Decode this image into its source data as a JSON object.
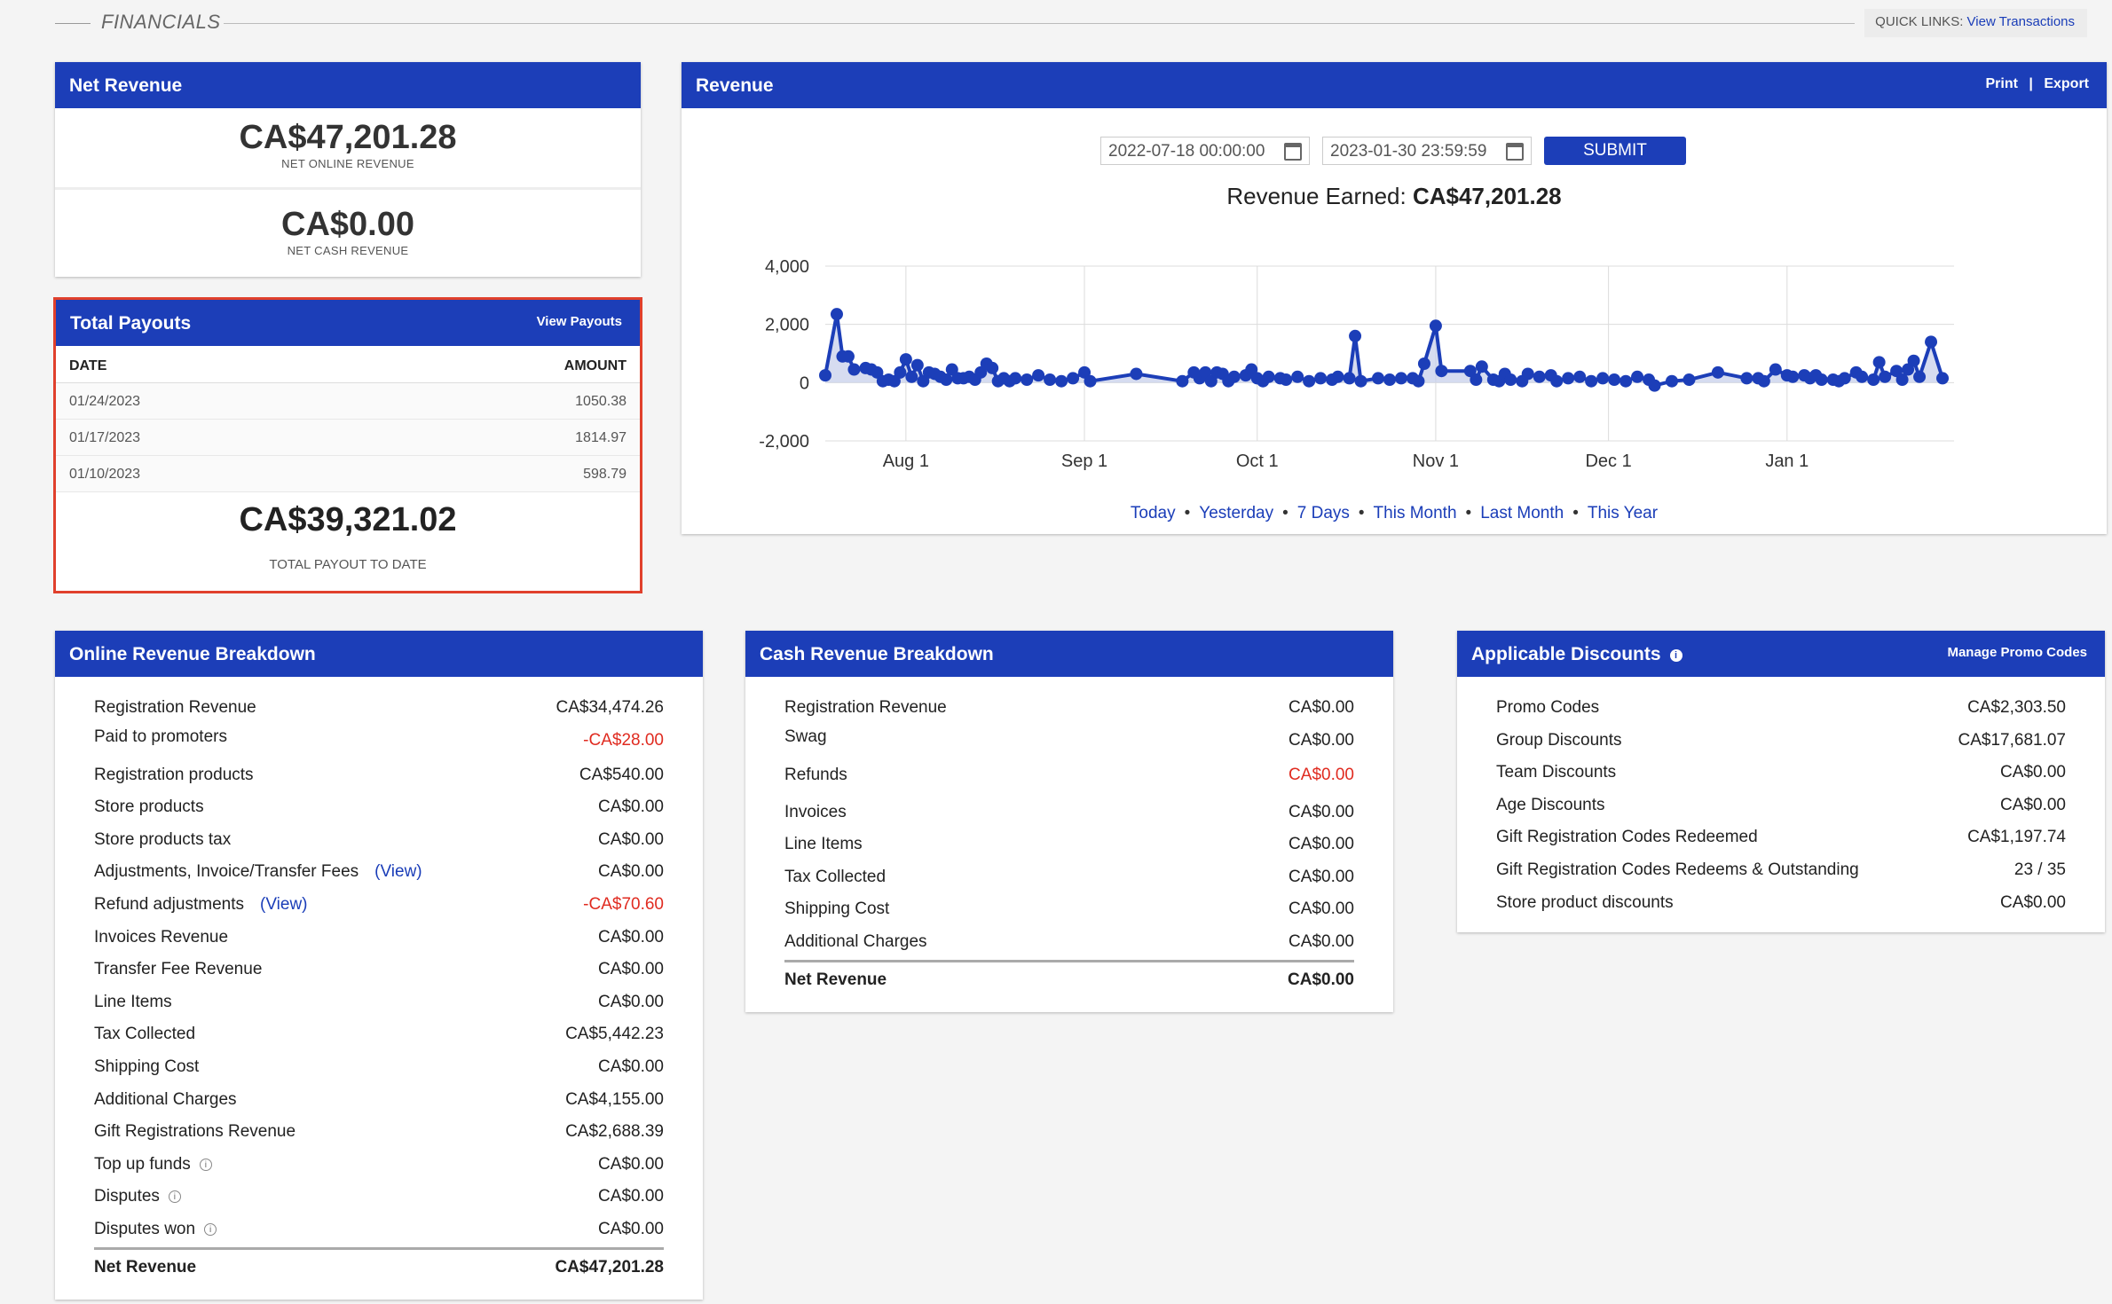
{
  "header": {
    "section_title": "FINANCIALS",
    "quick_links_label": "QUICK LINKS:",
    "quick_links_link": "View Transactions"
  },
  "net_revenue": {
    "title": "Net Revenue",
    "online_value": "CA$47,201.28",
    "online_caption": "NET ONLINE REVENUE",
    "cash_value": "CA$0.00",
    "cash_caption": "NET CASH REVENUE"
  },
  "payouts": {
    "title": "Total Payouts",
    "view_link": "View Payouts",
    "col_date": "DATE",
    "col_amount": "AMOUNT",
    "rows": [
      {
        "date": "01/24/2023",
        "amount": "1050.38"
      },
      {
        "date": "01/17/2023",
        "amount": "1814.97"
      },
      {
        "date": "01/10/2023",
        "amount": "598.79"
      }
    ],
    "total": "CA$39,321.02",
    "total_caption": "TOTAL PAYOUT TO DATE"
  },
  "revenue": {
    "title": "Revenue",
    "print": "Print",
    "separator": "|",
    "export": "Export",
    "start_date": "2022-07-18 00:00:00",
    "end_date": "2023-01-30 23:59:59",
    "submit": "SUBMIT",
    "earned_label": "Revenue Earned:",
    "earned_value": "CA$47,201.28",
    "ranges": [
      "Today",
      "Yesterday",
      "7 Days",
      "This Month",
      "Last Month",
      "This Year"
    ],
    "range_separator": "•"
  },
  "chart_data": {
    "type": "line",
    "title": "",
    "xlabel": "",
    "ylabel": "",
    "ylim": [
      -2000,
      4000
    ],
    "y_ticks": [
      "4,000",
      "2,000",
      "0",
      "-2,000"
    ],
    "y_tick_values": [
      4000,
      2000,
      0,
      -2000
    ],
    "x_ticks": [
      "Aug 1",
      "Sep 1",
      "Oct 1",
      "Nov 1",
      "Dec 1",
      "Jan 1"
    ],
    "x_tick_dates": [
      "2022-08-01",
      "2022-09-01",
      "2022-10-01",
      "2022-11-01",
      "2022-12-01",
      "2023-01-01"
    ],
    "x_range": [
      "2022-07-18",
      "2023-01-30"
    ],
    "grid": true,
    "series_color": "#1c3eb8",
    "area_fill": "#c5cdea",
    "series": [
      {
        "name": "",
        "points": [
          [
            "2022-07-18",
            250
          ],
          [
            "2022-07-20",
            2350
          ],
          [
            "2022-07-21",
            900
          ],
          [
            "2022-07-22",
            900
          ],
          [
            "2022-07-23",
            450
          ],
          [
            "2022-07-25",
            500
          ],
          [
            "2022-07-26",
            450
          ],
          [
            "2022-07-27",
            350
          ],
          [
            "2022-07-28",
            50
          ],
          [
            "2022-07-29",
            100
          ],
          [
            "2022-07-30",
            50
          ],
          [
            "2022-07-31",
            350
          ],
          [
            "2022-08-01",
            800
          ],
          [
            "2022-08-02",
            200
          ],
          [
            "2022-08-03",
            600
          ],
          [
            "2022-08-04",
            50
          ],
          [
            "2022-08-05",
            350
          ],
          [
            "2022-08-06",
            300
          ],
          [
            "2022-08-07",
            200
          ],
          [
            "2022-08-08",
            100
          ],
          [
            "2022-08-09",
            450
          ],
          [
            "2022-08-10",
            150
          ],
          [
            "2022-08-11",
            150
          ],
          [
            "2022-08-12",
            200
          ],
          [
            "2022-08-13",
            100
          ],
          [
            "2022-08-14",
            350
          ],
          [
            "2022-08-15",
            650
          ],
          [
            "2022-08-16",
            500
          ],
          [
            "2022-08-17",
            50
          ],
          [
            "2022-08-18",
            150
          ],
          [
            "2022-08-19",
            50
          ],
          [
            "2022-08-20",
            150
          ],
          [
            "2022-08-22",
            100
          ],
          [
            "2022-08-24",
            250
          ],
          [
            "2022-08-26",
            100
          ],
          [
            "2022-08-28",
            50
          ],
          [
            "2022-08-30",
            150
          ],
          [
            "2022-09-01",
            350
          ],
          [
            "2022-09-02",
            50
          ],
          [
            "2022-09-10",
            300
          ],
          [
            "2022-09-18",
            50
          ],
          [
            "2022-09-20",
            350
          ],
          [
            "2022-09-21",
            150
          ],
          [
            "2022-09-22",
            350
          ],
          [
            "2022-09-23",
            50
          ],
          [
            "2022-09-24",
            350
          ],
          [
            "2022-09-25",
            300
          ],
          [
            "2022-09-26",
            50
          ],
          [
            "2022-09-27",
            200
          ],
          [
            "2022-09-29",
            250
          ],
          [
            "2022-09-30",
            450
          ],
          [
            "2022-10-01",
            150
          ],
          [
            "2022-10-02",
            50
          ],
          [
            "2022-10-03",
            200
          ],
          [
            "2022-10-05",
            150
          ],
          [
            "2022-10-06",
            100
          ],
          [
            "2022-10-08",
            200
          ],
          [
            "2022-10-10",
            50
          ],
          [
            "2022-10-12",
            150
          ],
          [
            "2022-10-14",
            100
          ],
          [
            "2022-10-15",
            200
          ],
          [
            "2022-10-17",
            150
          ],
          [
            "2022-10-18",
            1600
          ],
          [
            "2022-10-19",
            50
          ],
          [
            "2022-10-22",
            150
          ],
          [
            "2022-10-24",
            100
          ],
          [
            "2022-10-26",
            150
          ],
          [
            "2022-10-28",
            150
          ],
          [
            "2022-10-29",
            50
          ],
          [
            "2022-10-30",
            650
          ],
          [
            "2022-11-01",
            1950
          ],
          [
            "2022-11-02",
            400
          ],
          [
            "2022-11-07",
            400
          ],
          [
            "2022-11-08",
            100
          ],
          [
            "2022-11-09",
            550
          ],
          [
            "2022-11-11",
            100
          ],
          [
            "2022-11-12",
            50
          ],
          [
            "2022-11-13",
            300
          ],
          [
            "2022-11-14",
            100
          ],
          [
            "2022-11-16",
            50
          ],
          [
            "2022-11-17",
            300
          ],
          [
            "2022-11-19",
            200
          ],
          [
            "2022-11-21",
            250
          ],
          [
            "2022-11-22",
            50
          ],
          [
            "2022-11-24",
            150
          ],
          [
            "2022-11-26",
            200
          ],
          [
            "2022-11-28",
            50
          ],
          [
            "2022-11-30",
            150
          ],
          [
            "2022-12-02",
            100
          ],
          [
            "2022-12-04",
            50
          ],
          [
            "2022-12-06",
            200
          ],
          [
            "2022-12-08",
            100
          ],
          [
            "2022-12-09",
            -100
          ],
          [
            "2022-12-12",
            50
          ],
          [
            "2022-12-15",
            100
          ],
          [
            "2022-12-20",
            350
          ],
          [
            "2022-12-25",
            150
          ],
          [
            "2022-12-27",
            150
          ],
          [
            "2022-12-28",
            50
          ],
          [
            "2022-12-30",
            450
          ],
          [
            "2023-01-01",
            250
          ],
          [
            "2023-01-02",
            200
          ],
          [
            "2023-01-04",
            250
          ],
          [
            "2023-01-05",
            150
          ],
          [
            "2023-01-06",
            250
          ],
          [
            "2023-01-07",
            100
          ],
          [
            "2023-01-09",
            100
          ],
          [
            "2023-01-10",
            50
          ],
          [
            "2023-01-11",
            150
          ],
          [
            "2023-01-13",
            350
          ],
          [
            "2023-01-14",
            200
          ],
          [
            "2023-01-16",
            100
          ],
          [
            "2023-01-17",
            700
          ],
          [
            "2023-01-18",
            200
          ],
          [
            "2023-01-20",
            400
          ],
          [
            "2023-01-21",
            100
          ],
          [
            "2023-01-22",
            450
          ],
          [
            "2023-01-23",
            750
          ],
          [
            "2023-01-24",
            200
          ],
          [
            "2023-01-26",
            1400
          ],
          [
            "2023-01-28",
            150
          ]
        ]
      }
    ]
  },
  "online_breakdown": {
    "title": "Online Revenue Breakdown",
    "view_label": "(View)",
    "info_glyph": "i",
    "rows": [
      {
        "label": "Registration Revenue",
        "value": "CA$34,474.26"
      },
      {
        "label": "Paid to promoters",
        "value": "-CA$28.00"
      },
      {
        "label": "Registration products",
        "value": "CA$540.00"
      },
      {
        "label": "Store products",
        "value": "CA$0.00"
      },
      {
        "label": "Store products tax",
        "value": "CA$0.00"
      },
      {
        "label": "Adjustments, Invoice/Transfer Fees",
        "value": "CA$0.00"
      },
      {
        "label": "Refund adjustments",
        "value": "-CA$70.60"
      },
      {
        "label": "Invoices Revenue",
        "value": "CA$0.00"
      },
      {
        "label": "Transfer Fee Revenue",
        "value": "CA$0.00"
      },
      {
        "label": "Line Items",
        "value": "CA$0.00"
      },
      {
        "label": "Tax Collected",
        "value": "CA$5,442.23"
      },
      {
        "label": "Shipping Cost",
        "value": "CA$0.00"
      },
      {
        "label": "Additional Charges",
        "value": "CA$4,155.00"
      },
      {
        "label": "Gift Registrations Revenue",
        "value": "CA$2,688.39"
      },
      {
        "label": "Top up funds",
        "value": "CA$0.00"
      },
      {
        "label": "Disputes",
        "value": "CA$0.00"
      },
      {
        "label": "Disputes won",
        "value": "CA$0.00"
      }
    ],
    "total_label": "Net Revenue",
    "total_value": "CA$47,201.28"
  },
  "cash_breakdown": {
    "title": "Cash Revenue Breakdown",
    "rows": [
      {
        "label": "Registration Revenue",
        "value": "CA$0.00"
      },
      {
        "label": "Swag",
        "value": "CA$0.00"
      },
      {
        "label": "Refunds",
        "value": "CA$0.00"
      },
      {
        "label": "Invoices",
        "value": "CA$0.00"
      },
      {
        "label": "Line Items",
        "value": "CA$0.00"
      },
      {
        "label": "Tax Collected",
        "value": "CA$0.00"
      },
      {
        "label": "Shipping Cost",
        "value": "CA$0.00"
      },
      {
        "label": "Additional Charges",
        "value": "CA$0.00"
      }
    ],
    "total_label": "Net Revenue",
    "total_value": "CA$0.00"
  },
  "discounts": {
    "title": "Applicable Discounts",
    "info_glyph": "i",
    "manage_link": "Manage Promo Codes",
    "rows": [
      {
        "label": "Promo Codes",
        "value": "CA$2,303.50"
      },
      {
        "label": "Group Discounts",
        "value": "CA$17,681.07"
      },
      {
        "label": "Team Discounts",
        "value": "CA$0.00"
      },
      {
        "label": "Age Discounts",
        "value": "CA$0.00"
      },
      {
        "label": "Gift Registration Codes Redeemed",
        "value": "CA$1,197.74"
      },
      {
        "label": "Gift Registration Codes Redeems & Outstanding",
        "value": "23 / 35"
      },
      {
        "label": "Store product discounts",
        "value": "CA$0.00"
      }
    ]
  }
}
